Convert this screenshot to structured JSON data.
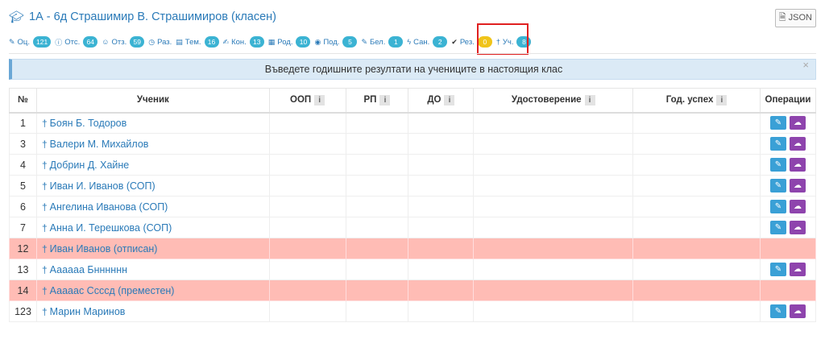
{
  "header": {
    "title": "1А - 6д Страшимир В. Страшимиров (класен)",
    "json_label": "JSON"
  },
  "tabs": [
    {
      "icon": "pencil-icon",
      "label": "Оц.",
      "count": "121",
      "active": false
    },
    {
      "icon": "info-circle-icon",
      "label": "Отс.",
      "count": "64",
      "active": false
    },
    {
      "icon": "users-icon",
      "label": "Отз.",
      "count": "59",
      "active": false
    },
    {
      "icon": "clock-icon",
      "label": "Раз.",
      "count": "",
      "active": false
    },
    {
      "icon": "table-icon",
      "label": "Тем.",
      "count": "16",
      "active": false
    },
    {
      "icon": "edit-icon",
      "label": "Кон.",
      "count": "13",
      "active": false
    },
    {
      "icon": "calendar-icon",
      "label": "Род.",
      "count": "10",
      "active": false
    },
    {
      "icon": "eye-icon",
      "label": "Под.",
      "count": "5",
      "active": false
    },
    {
      "icon": "note-icon",
      "label": "Бел.",
      "count": "1",
      "active": false
    },
    {
      "icon": "bolt-icon",
      "label": "Сан.",
      "count": "2",
      "active": false
    },
    {
      "icon": "check-circle-icon",
      "label": "Рез.",
      "count": "0",
      "active": true
    },
    {
      "icon": "person-icon",
      "label": "Уч.",
      "count": "8",
      "active": false
    }
  ],
  "alert": {
    "text": "Въведете годишните резултати на учениците в настоящия клас",
    "close": "×"
  },
  "table": {
    "columns": [
      "№",
      "Ученик",
      "ООП",
      "РП",
      "ДО",
      "Удостоверение",
      "Год. успех",
      "Операции"
    ],
    "info_glyph": "i",
    "rows": [
      {
        "num": "1",
        "name": "Боян Б. Тодоров",
        "removed": false
      },
      {
        "num": "3",
        "name": "Валери М. Михайлов",
        "removed": false
      },
      {
        "num": "4",
        "name": "Добрин Д. Хайне",
        "removed": false
      },
      {
        "num": "5",
        "name": "Иван И. Иванов (СОП)",
        "removed": false
      },
      {
        "num": "6",
        "name": "Ангелина Иванова (СОП)",
        "removed": false
      },
      {
        "num": "7",
        "name": "Анна И. Терешкова (СОП)",
        "removed": false
      },
      {
        "num": "12",
        "name": "Иван Иванов (отписан)",
        "removed": true
      },
      {
        "num": "13",
        "name": "Аааааа Бнннннн",
        "removed": false
      },
      {
        "num": "14",
        "name": "Ааааас Ссссд (преместен)",
        "removed": true
      },
      {
        "num": "123",
        "name": "Марин Маринов",
        "removed": false
      }
    ]
  },
  "colors": {
    "link": "#2a7ab8",
    "badge": "#3bb3d3",
    "badge_active": "#f0c419",
    "removed_row": "#ffbcb5",
    "edit_button": "#3aa0d6",
    "upload_button": "#8e44ad"
  }
}
